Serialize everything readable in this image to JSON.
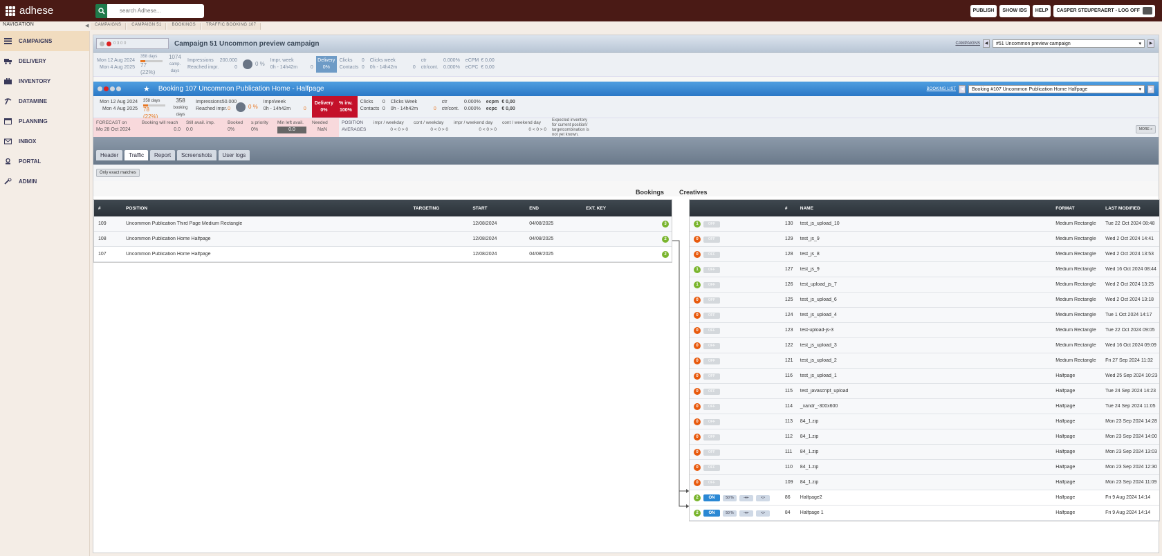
{
  "app": {
    "logo": "adhese",
    "search_placeholder": "search Adhese..."
  },
  "topbar": {
    "buttons": [
      "PUBLISH",
      "SHOW IDS",
      "HELP",
      "CASPER STEUPERAERT - LOG OFF"
    ]
  },
  "nav": {
    "label": "NAVIGATION",
    "items": [
      "CAMPAIGNS",
      "DELIVERY",
      "INVENTORY",
      "DATAMINE",
      "PLANNING",
      "INBOX",
      "PORTAL",
      "ADMIN"
    ]
  },
  "breadcrumb": [
    "CAMPAIGNS",
    "CAMPAIGN 51",
    "BOOKINGS",
    "TRAFFIC BOOKING 107"
  ],
  "campaign": {
    "controls": "0  3  0  0",
    "title": "Campaign 51   Uncommon preview campaign",
    "link": "CAMPAIGNS",
    "selector": "#51 Uncommon preview campaign",
    "start": "Mon 12 Aug 2024",
    "end": "Mon 4 Aug 2025",
    "days_label": "358 days",
    "days_pct": "77 (22%)",
    "camp_days": "1074",
    "camp_days_label": "camp. days",
    "impressions_label": "Impressions",
    "impressions": "200.000",
    "reached_label": "Reached impr.",
    "reached": "0",
    "pct": "0 %",
    "impr_week_label": "Impr. week",
    "impr_week_time": "0h - 14h42m",
    "impr_week": "0",
    "delivery_label": "Delivery",
    "delivery_pct": "0%",
    "clicks_label": "Clicks",
    "clicks": "0",
    "contacts_label": "Contacts",
    "contacts": "0",
    "clicks_week_label": "Clicks week",
    "clicks_week_time": "0h - 14h42m",
    "clicks_week": "0",
    "ctr_label": "ctr",
    "ctr": "0.000%",
    "ctrcont_label": "ctr/cont.",
    "ctrcont": "0.000%",
    "ecpm_label": "eCPM",
    "ecpm": "€ 0,00",
    "ecpc_label": "eCPC",
    "ecpc": "€ 0,00"
  },
  "booking": {
    "title": "Booking 107   Uncommon Publication Home - Halfpage",
    "link": "BOOKING LIST",
    "selector": "Booking #107 Uncommon Publication Home Halfpage",
    "start": "Mon 12 Aug 2024",
    "end": "Mon 4 Aug 2025",
    "days_label": "358 days",
    "days_pct": "78 (22%)",
    "booking_days": "358",
    "booking_days_label": "booking days",
    "impressions_label": "Impressions",
    "impressions": "50.000",
    "reached_label": "Reached impr.",
    "reached": "0",
    "pct": "0 %",
    "imprweek_label": "Impr/week",
    "imprweek_time": "0h - 14h42m",
    "imprweek": "0",
    "delivery_label": "Delivery",
    "delivery_pct": "0%",
    "inv_label": "% inv.",
    "inv_pct": "100%",
    "clicks_label": "Clicks",
    "clicks": "0",
    "contacts_label": "Contacts",
    "contacts": "0",
    "clicks_week_label": "Clicks Week",
    "clicks_week_time": "0h - 14h42m",
    "clicks_week": "0",
    "ctr_label": "ctr",
    "ctr": "0.000%",
    "ctrcont_label": "ctr/cont.",
    "ctrcont": "0.000%",
    "ecpm_label": "ecpm",
    "ecpm": "€ 0,00",
    "ecpc_label": "ecpc",
    "ecpc": "€ 0,00"
  },
  "forecast": {
    "label": "FORECAST on",
    "date": "Mo 28 Oct 2024",
    "will_reach_label": "Booking will reach",
    "will_reach": "0.0",
    "still_avail_label": "Still avail. imp.",
    "still_avail": "0.0",
    "booked_label": "Booked",
    "booked": "0%",
    "priority_label": "≥ priority",
    "priority": "0%",
    "min_left_label": "Min left avail.",
    "min_left": "0.0",
    "needed_label": "Needed",
    "needed": "NaN",
    "pos_avg_label": "POSITION AVERAGES",
    "impr_weekday_label": "impr / weekday",
    "impr_weekday": "0 < 0 > 0",
    "cont_weekday_label": "cont / weekday",
    "cont_weekday": "0 < 0 > 0",
    "impr_weekend_label": "impr / weekend day",
    "impr_weekend": "0 < 0 > 0",
    "cont_weekend_label": "cont / weekend day",
    "cont_weekend": "0 < 0 > 0",
    "note": "Expected inventory for current position/ targetcombination is not yet known.",
    "more": "MORE »"
  },
  "tabs": [
    "Header",
    "Traffic",
    "Report",
    "Screenshots",
    "User logs"
  ],
  "filter": {
    "exact": "Only exact matches"
  },
  "sections": {
    "bookings": "Bookings",
    "creatives": "Creatives"
  },
  "bookings_table": {
    "columns": [
      "#",
      "POSITION",
      "TARGETING",
      "START",
      "END",
      "EXT. KEY"
    ],
    "rows": [
      {
        "id": "109",
        "position": "Uncommon Publication Third Page Medium Rectangle",
        "targeting": "",
        "start": "12/08/2024",
        "end": "04/08/2025",
        "ext": "",
        "count": "3"
      },
      {
        "id": "108",
        "position": "Uncommon Publication Home Halfpage",
        "targeting": "",
        "start": "12/08/2024",
        "end": "04/08/2025",
        "ext": "",
        "count": "2"
      },
      {
        "id": "107",
        "position": "Uncommon Publication Home Halfpage",
        "targeting": "",
        "start": "12/08/2024",
        "end": "04/08/2025",
        "ext": "",
        "count": "2"
      }
    ]
  },
  "creatives_table": {
    "columns": [
      "",
      "#",
      "NAME",
      "FORMAT",
      "LAST MODIFIED"
    ],
    "rows": [
      {
        "count": "1",
        "state": "OFF",
        "id": "130",
        "name": "test_js_upload_10",
        "format": "Medium Rectangle",
        "modified": "Tue 22 Oct 2024 08:48"
      },
      {
        "count": "0",
        "state": "OFF",
        "id": "129",
        "name": "test_js_9",
        "format": "Medium Rectangle",
        "modified": "Wed 2 Oct 2024 14:41"
      },
      {
        "count": "0",
        "state": "OFF",
        "id": "128",
        "name": "test_js_8",
        "format": "Medium Rectangle",
        "modified": "Wed 2 Oct 2024 13:53"
      },
      {
        "count": "1",
        "state": "OFF",
        "id": "127",
        "name": "test_js_9",
        "format": "Medium Rectangle",
        "modified": "Wed 16 Oct 2024 08:44"
      },
      {
        "count": "1",
        "state": "OFF",
        "id": "126",
        "name": "test_upload_js_7",
        "format": "Medium Rectangle",
        "modified": "Wed 2 Oct 2024 13:25"
      },
      {
        "count": "0",
        "state": "OFF",
        "id": "125",
        "name": "test_js_upload_6",
        "format": "Medium Rectangle",
        "modified": "Wed 2 Oct 2024 13:18"
      },
      {
        "count": "0",
        "state": "OFF",
        "id": "124",
        "name": "test_js_upload_4",
        "format": "Medium Rectangle",
        "modified": "Tue 1 Oct 2024 14:17"
      },
      {
        "count": "0",
        "state": "OFF",
        "id": "123",
        "name": "test-upload-js-3",
        "format": "Medium Rectangle",
        "modified": "Tue 22 Oct 2024 09:05"
      },
      {
        "count": "0",
        "state": "OFF",
        "id": "122",
        "name": "test_js_upload_3",
        "format": "Medium Rectangle",
        "modified": "Wed 16 Oct 2024 09:09"
      },
      {
        "count": "0",
        "state": "OFF",
        "id": "121",
        "name": "test_js_upload_2",
        "format": "Medium Rectangle",
        "modified": "Fri 27 Sep 2024 11:32"
      },
      {
        "count": "0",
        "state": "OFF",
        "id": "116",
        "name": "test_js_upload_1",
        "format": "Halfpage",
        "modified": "Wed 25 Sep 2024 10:23"
      },
      {
        "count": "0",
        "state": "OFF",
        "id": "115",
        "name": "test_javascript_upload",
        "format": "Halfpage",
        "modified": "Tue 24 Sep 2024 14:23"
      },
      {
        "count": "0",
        "state": "OFF",
        "id": "114",
        "name": "_xandr_-300x600",
        "format": "Halfpage",
        "modified": "Tue 24 Sep 2024 11:05"
      },
      {
        "count": "0",
        "state": "OFF",
        "id": "113",
        "name": "84_1.zip",
        "format": "Halfpage",
        "modified": "Mon 23 Sep 2024 14:28"
      },
      {
        "count": "0",
        "state": "OFF",
        "id": "112",
        "name": "84_1.zip",
        "format": "Halfpage",
        "modified": "Mon 23 Sep 2024 14:00"
      },
      {
        "count": "0",
        "state": "OFF",
        "id": "111",
        "name": "84_1.zip",
        "format": "Halfpage",
        "modified": "Mon 23 Sep 2024 13:03"
      },
      {
        "count": "0",
        "state": "OFF",
        "id": "110",
        "name": "84_1.zip",
        "format": "Halfpage",
        "modified": "Mon 23 Sep 2024 12:30"
      },
      {
        "count": "0",
        "state": "OFF",
        "id": "109",
        "name": "84_1.zip",
        "format": "Halfpage",
        "modified": "Mon 23 Sep 2024 11:09"
      },
      {
        "count": "2",
        "state": "ON",
        "weight": "50 %",
        "id": "86",
        "name": "Halfpage2",
        "format": "Halfpage",
        "modified": "Fri 9 Aug 2024 14:14"
      },
      {
        "count": "2",
        "state": "ON",
        "weight": "50 %",
        "id": "84",
        "name": "Halfpage 1",
        "format": "Halfpage",
        "modified": "Fri 9 Aug 2024 14:14"
      }
    ]
  }
}
